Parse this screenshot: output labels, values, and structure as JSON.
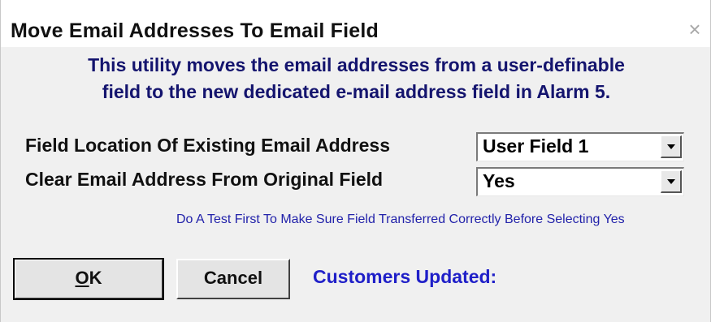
{
  "window": {
    "title": "Move Email Addresses To Email Field",
    "close_label": "×"
  },
  "intro": {
    "line1": "This utility moves the email addresses from a user-definable",
    "line2": "field to the new dedicated e-mail address field in Alarm 5."
  },
  "fields": {
    "location": {
      "label": "Field Location Of Existing Email Address",
      "value": "User Field 1"
    },
    "clear_original": {
      "label": "Clear Email Address From Original Field",
      "value": "Yes"
    }
  },
  "hint": "Do A Test First To Make Sure Field Transferred Correctly Before Selecting Yes",
  "buttons": {
    "ok_mnemonic": "O",
    "ok_rest": "K",
    "cancel": "Cancel"
  },
  "status": {
    "customers_updated_label": "Customers Updated:"
  },
  "icons": {
    "dropdown": "chevron-down-icon",
    "close": "close-icon"
  },
  "colors": {
    "intro_text": "#14146e",
    "hint_text": "#2222aa",
    "status_text": "#1f1fc8",
    "dialog_bg": "#f0f0f0"
  }
}
